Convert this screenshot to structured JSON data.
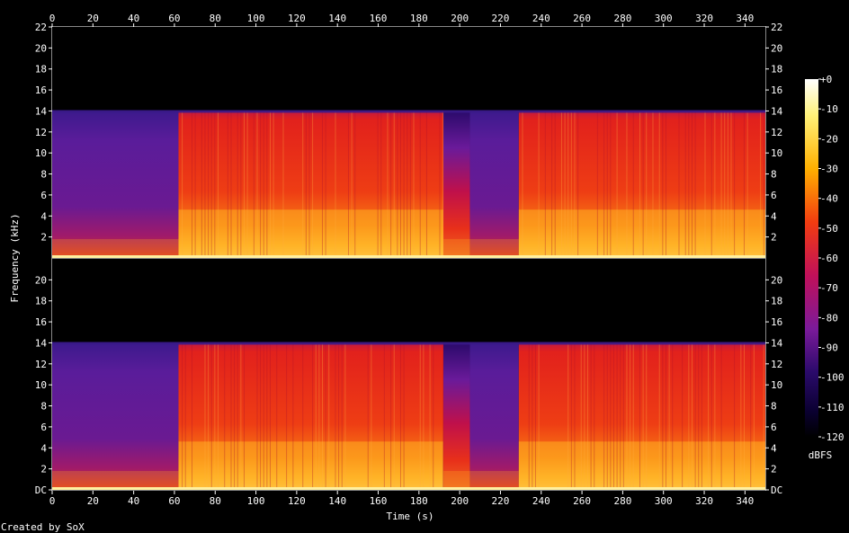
{
  "chart_data": {
    "type": "heatmap",
    "title": "",
    "xlabel": "Time (s)",
    "ylabel": "Frequency (kHz)",
    "xlim": [
      0,
      350
    ],
    "ylim": [
      0,
      22
    ],
    "x_ticks": [
      "0",
      "20",
      "40",
      "60",
      "80",
      "100",
      "120",
      "140",
      "160",
      "180",
      "200",
      "220",
      "240",
      "260",
      "280",
      "300",
      "320",
      "340"
    ],
    "y_ticks_top": [
      "2",
      "4",
      "6",
      "8",
      "10",
      "12",
      "14",
      "16",
      "18",
      "20",
      "22"
    ],
    "y_ticks_bottom": [
      "DC",
      "2",
      "4",
      "6",
      "8",
      "10",
      "12",
      "14",
      "16",
      "18",
      "20"
    ],
    "colorbar": {
      "label": "dBFS",
      "ticks": [
        "+0",
        "-10",
        "-20",
        "-30",
        "-40",
        "-50",
        "-60",
        "-70",
        "-80",
        "-90",
        "-100",
        "-110",
        "-120"
      ]
    },
    "channels": 2,
    "bandwidth_khz": 14,
    "segments": [
      {
        "start": 0,
        "end": 62,
        "level": "quiet"
      },
      {
        "start": 62,
        "end": 192,
        "level": "loud"
      },
      {
        "start": 192,
        "end": 205,
        "level": "fade"
      },
      {
        "start": 205,
        "end": 229,
        "level": "quiet"
      },
      {
        "start": 229,
        "end": 350,
        "level": "loud"
      }
    ],
    "colors": {
      "quiet": "#5a1a9a",
      "loud": "#e8261a",
      "low_band": "#ffb020",
      "baseline": "#fff0a0",
      "top_edge": "#3a1a8a"
    }
  },
  "footer": {
    "credit": "Created by SoX"
  }
}
